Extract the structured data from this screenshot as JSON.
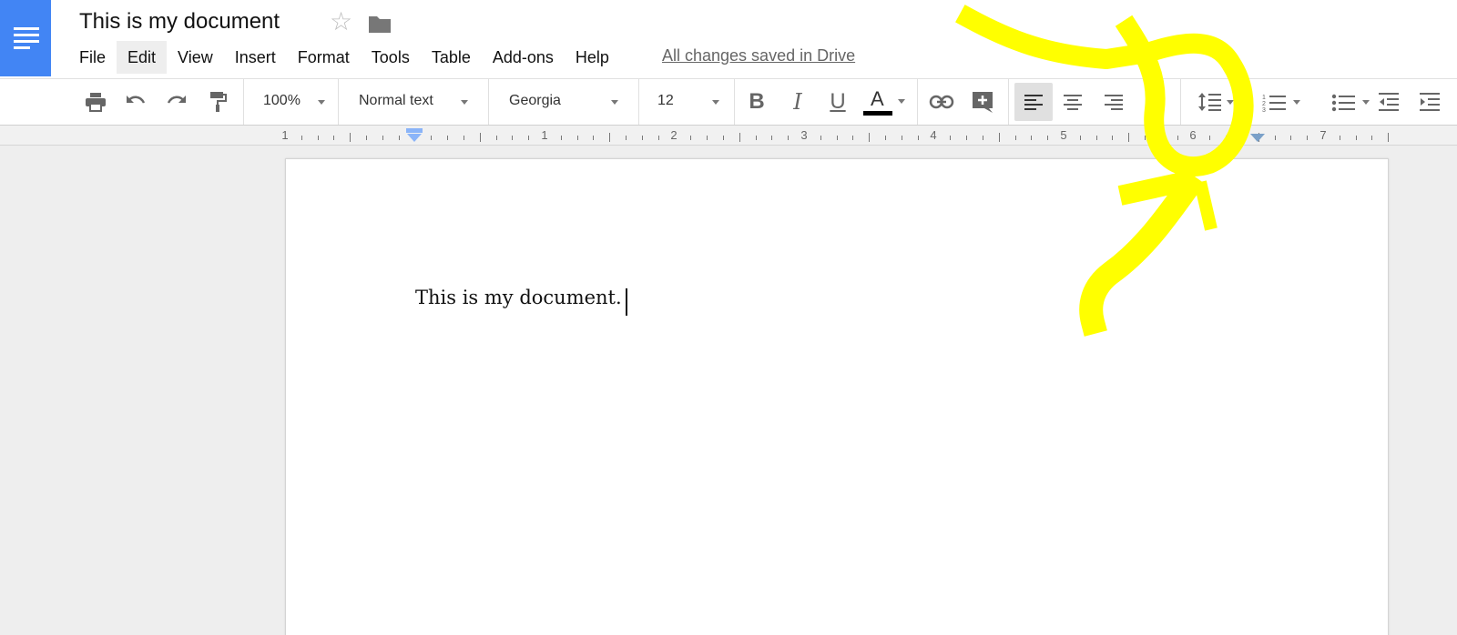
{
  "document": {
    "title": "This is my document",
    "body_text": "This is my document."
  },
  "menubar": {
    "items": [
      "File",
      "Edit",
      "View",
      "Insert",
      "Format",
      "Tools",
      "Table",
      "Add-ons",
      "Help"
    ],
    "active": "Edit"
  },
  "status": {
    "saved": "All changes saved in Drive"
  },
  "toolbar": {
    "zoom": "100%",
    "style": "Normal text",
    "font": "Georgia",
    "font_size": "12",
    "bold": "B",
    "italic": "I",
    "underline": "U",
    "text_color_letter": "A"
  },
  "ruler": {
    "labels": [
      "1",
      "1",
      "2",
      "3",
      "4",
      "5",
      "6",
      "7"
    ]
  },
  "colors": {
    "brand": "#4285f4",
    "annotation": "#ffff00",
    "text_color": "#000000"
  },
  "icons": [
    "docs-logo-icon",
    "star-icon",
    "folder-icon",
    "print-icon",
    "undo-icon",
    "redo-icon",
    "paint-format-icon",
    "link-icon",
    "add-comment-icon",
    "align-left-icon",
    "align-center-icon",
    "align-right-icon",
    "justify-icon",
    "line-spacing-icon",
    "numbered-list-icon",
    "bulleted-list-icon",
    "decrease-indent-icon",
    "increase-indent-icon"
  ]
}
